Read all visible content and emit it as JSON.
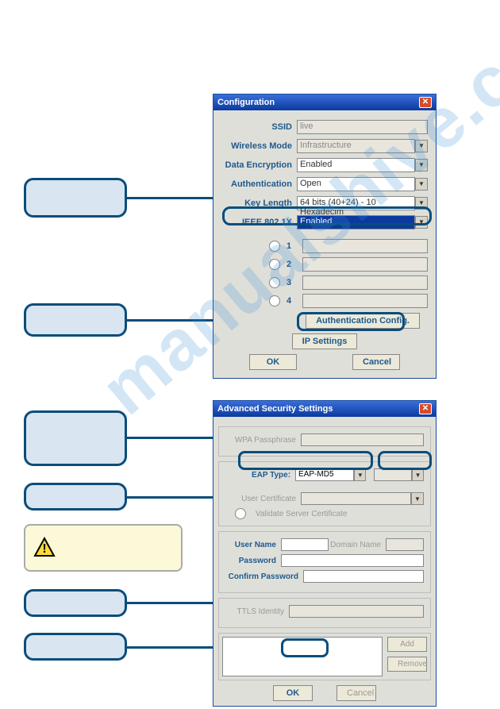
{
  "watermark": "manualshive.com",
  "win1": {
    "title": "Configuration",
    "ssid_label": "SSID",
    "ssid_value": "live",
    "wmode_label": "Wireless Mode",
    "wmode_value": "Infrastructure",
    "dataenc_label": "Data Encryption",
    "dataenc_value": "Enabled",
    "auth_label": "Authentication",
    "auth_value": "Open",
    "keylen_label": "Key Length",
    "keylen_value": "64 bits (40+24) - 10 Hexadecim",
    "ieee_label": "IEEE 802.1X",
    "ieee_value": "Enabled",
    "keys": [
      "1",
      "2",
      "3",
      "4"
    ],
    "authcfg_btn": "Authentication Config.",
    "ipset_btn": "IP Settings",
    "ok_btn": "OK",
    "cancel_btn": "Cancel"
  },
  "win2": {
    "title": "Advanced Security Settings",
    "wpa_label": "WPA Passphrase",
    "eap_label": "EAP Type:",
    "eap_value": "EAP-MD5",
    "usercert_label": "User Certificate",
    "validate_label": "Validate Server Certificate",
    "username_label": "User Name",
    "domain_label": "Domain Name",
    "password_label": "Password",
    "confirm_label": "Confirm Password",
    "ttls_label": "TTLS Identity",
    "add_btn": "Add",
    "remove_btn": "Remove",
    "ok_btn": "OK",
    "cancel_btn": "Cancel"
  }
}
